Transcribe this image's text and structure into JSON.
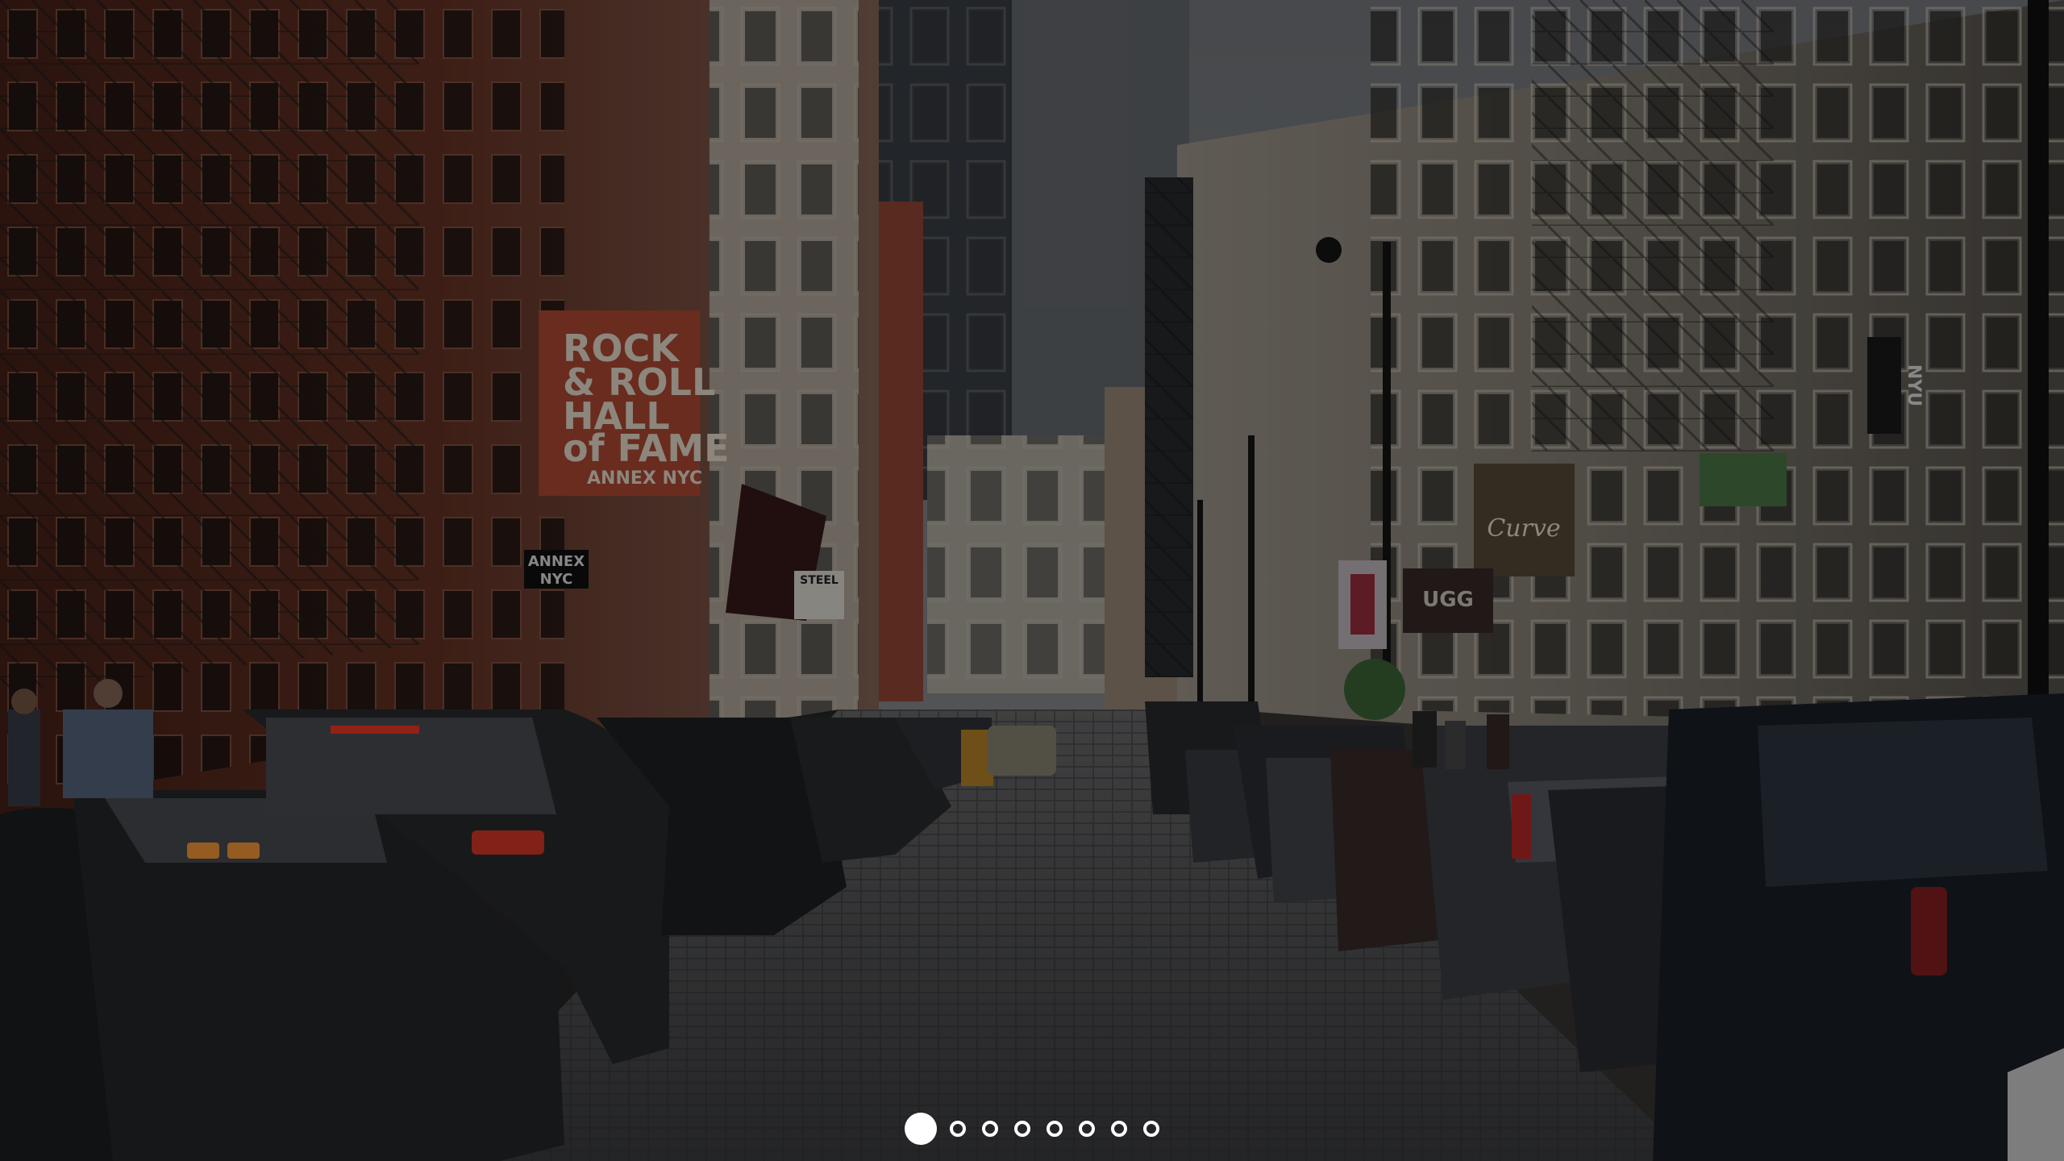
{
  "slideshow": {
    "photo": {
      "subject": "cobblestone-street-with-parked-cars",
      "signs": {
        "hall_of_fame_lines": [
          "ROCK",
          "& ROLL",
          "HALL",
          "of FAME",
          "ANNEX NYC"
        ],
        "annex_small": [
          "ANNEX",
          "NYC"
        ],
        "curve_banner": "Curve",
        "ugg_banner": "UGG",
        "nyu_vertical": "NYU",
        "steel_sign": "STEEL"
      }
    },
    "pager": {
      "total": 8,
      "active_index": 0,
      "dots": [
        {
          "label": "slide-1"
        },
        {
          "label": "slide-2"
        },
        {
          "label": "slide-3"
        },
        {
          "label": "slide-4"
        },
        {
          "label": "slide-5"
        },
        {
          "label": "slide-6"
        },
        {
          "label": "slide-7"
        },
        {
          "label": "slide-8"
        }
      ]
    }
  },
  "colors": {
    "dot": "#ffffff",
    "overlay": "rgba(0,0,0,0.42)",
    "brick": "#5a2a1e",
    "sky": "#6b6f74"
  }
}
